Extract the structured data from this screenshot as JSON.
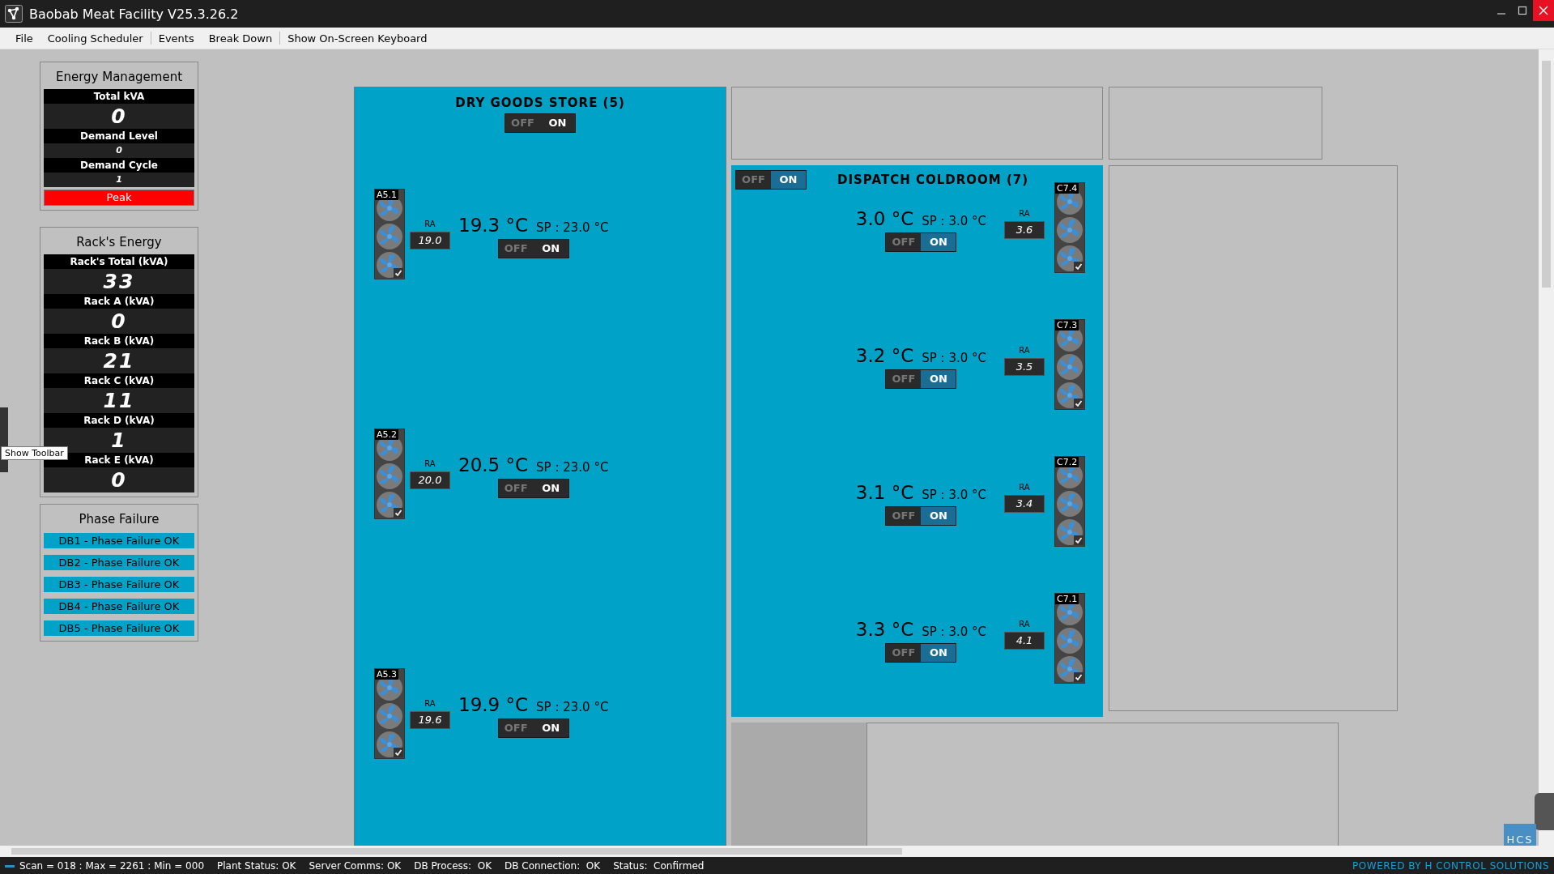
{
  "window": {
    "title": "Baobab Meat Facility V25.3.26.2"
  },
  "menu": [
    [
      "File",
      "Cooling Scheduler"
    ],
    [
      "Events",
      "Break Down"
    ],
    [
      "Show On-Screen Keyboard"
    ]
  ],
  "energy_management": {
    "title": "Energy Management",
    "rows": [
      {
        "label": "Total kVA",
        "value": "0",
        "kind": "large"
      },
      {
        "label": "Demand Level",
        "value": "0",
        "kind": "small"
      },
      {
        "label": "Demand Cycle",
        "value": "1",
        "kind": "small"
      }
    ],
    "status": {
      "label": "Peak",
      "color": "#ff0000"
    }
  },
  "racks_energy": {
    "title": "Rack's Energy",
    "rows": [
      {
        "label": "Rack's Total (kVA)",
        "value": "33",
        "kind": "large"
      },
      {
        "label": "Rack A (kVA)",
        "value": "0",
        "kind": "large"
      },
      {
        "label": "Rack B (kVA)",
        "value": "21",
        "kind": "large"
      },
      {
        "label": "Rack C (kVA)",
        "value": "11",
        "kind": "large"
      },
      {
        "label": "Rack D (kVA)",
        "value": "1",
        "kind": "large"
      },
      {
        "label": "Rack E (kVA)",
        "value": "0",
        "kind": "large"
      }
    ]
  },
  "phase_failure": {
    "title": "Phase Failure",
    "items": [
      "DB1 - Phase Failure OK",
      "DB2 - Phase Failure OK",
      "DB3 - Phase Failure OK",
      "DB4 - Phase Failure OK",
      "DB5 - Phase Failure OK"
    ]
  },
  "tooltip": "Show Toolbar",
  "rooms": [
    {
      "title": "DRY GOODS STORE (5)",
      "kind": "store",
      "switch": {
        "off": "OFF",
        "on_label": "ON",
        "on": true
      },
      "units": [
        {
          "tag": "A5.1",
          "ra_label": "RA",
          "ra": "19.0",
          "temp": "19.3 °C",
          "setpoint": "SP : 23.0 °C",
          "off": "OFF",
          "on_label": "ON",
          "on": true,
          "checked": true
        },
        {
          "tag": "A5.2",
          "ra_label": "RA",
          "ra": "20.0",
          "temp": "20.5 °C",
          "setpoint": "SP : 23.0 °C",
          "off": "OFF",
          "on_label": "ON",
          "on": true,
          "checked": true
        },
        {
          "tag": "A5.3",
          "ra_label": "RA",
          "ra": "19.6",
          "temp": "19.9 °C",
          "setpoint": "SP : 23.0 °C",
          "off": "OFF",
          "on_label": "ON",
          "on": true,
          "checked": true
        }
      ]
    },
    {
      "title": "DISPATCH COLDROOM (7)",
      "kind": "coldroom",
      "switch": {
        "off": "OFF",
        "on_label": "ON",
        "on": true
      },
      "units": [
        {
          "tag": "C7.4",
          "ra_label": "RA",
          "ra": "3.6",
          "temp": "3.0 °C",
          "setpoint": "SP : 3.0 °C",
          "off": "OFF",
          "on_label": "ON",
          "on": true,
          "checked": true
        },
        {
          "tag": "C7.3",
          "ra_label": "RA",
          "ra": "3.5",
          "temp": "3.2 °C",
          "setpoint": "SP : 3.0 °C",
          "off": "OFF",
          "on_label": "ON",
          "on": true,
          "checked": true
        },
        {
          "tag": "C7.2",
          "ra_label": "RA",
          "ra": "3.4",
          "temp": "3.1 °C",
          "setpoint": "SP : 3.0 °C",
          "off": "OFF",
          "on_label": "ON",
          "on": true,
          "checked": true
        },
        {
          "tag": "C7.1",
          "ra_label": "RA",
          "ra": "4.1",
          "temp": "3.3 °C",
          "setpoint": "SP : 3.0 °C",
          "off": "OFF",
          "on_label": "ON",
          "on": true,
          "checked": true
        }
      ]
    }
  ],
  "logo": "HCS",
  "status_bar": {
    "items": [
      "Scan = 018 : Max = 2261 : Min = 000",
      "Plant Status: OK",
      "Server Comms: OK",
      "DB Process:  OK",
      "DB Connection:  OK",
      "Status:  Confirmed"
    ],
    "powered_by": "POWERED BY H CONTROL SOLUTIONS"
  }
}
